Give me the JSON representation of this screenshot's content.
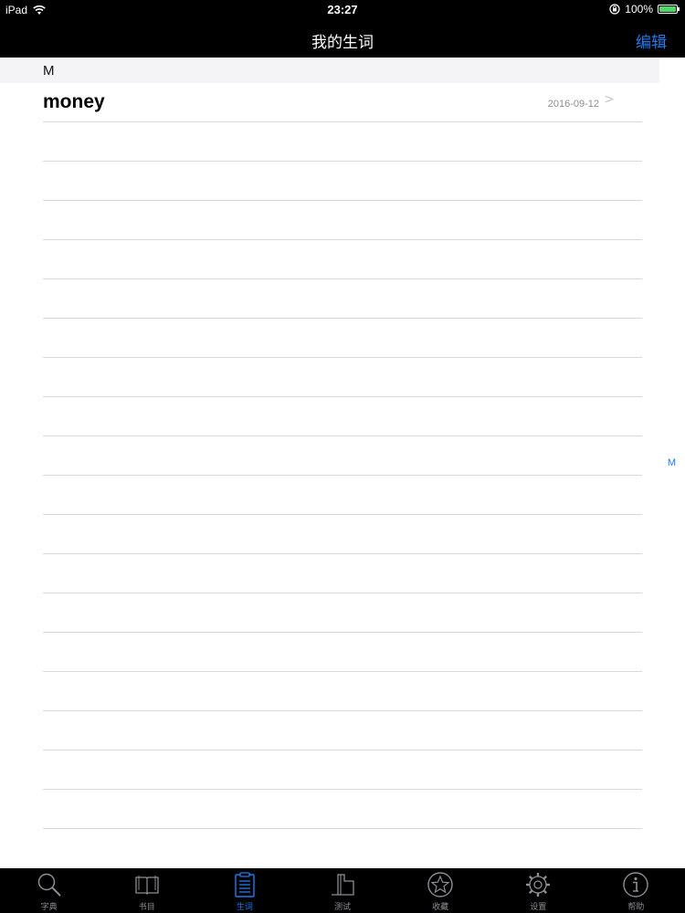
{
  "status_bar": {
    "device": "iPad",
    "time": "23:27",
    "battery": "100%"
  },
  "nav": {
    "title": "我的生词",
    "edit_label": "编辑"
  },
  "section": {
    "letter": "M"
  },
  "entries": [
    {
      "word": "money",
      "date": "2016-09-12"
    }
  ],
  "index_letters": [
    "M"
  ],
  "tabs": [
    {
      "label": "字典",
      "icon": "search-icon",
      "active": false
    },
    {
      "label": "书目",
      "icon": "book-icon",
      "active": false
    },
    {
      "label": "生词",
      "icon": "clipboard-icon",
      "active": true
    },
    {
      "label": "测试",
      "icon": "test-icon",
      "active": false
    },
    {
      "label": "收藏",
      "icon": "star-icon",
      "active": false
    },
    {
      "label": "设置",
      "icon": "gear-icon",
      "active": false
    },
    {
      "label": "帮助",
      "icon": "info-icon",
      "active": false
    }
  ],
  "colors": {
    "accent": "#1e7bf0",
    "bar_background": "#000000",
    "inactive_tab": "#8e8e93"
  }
}
